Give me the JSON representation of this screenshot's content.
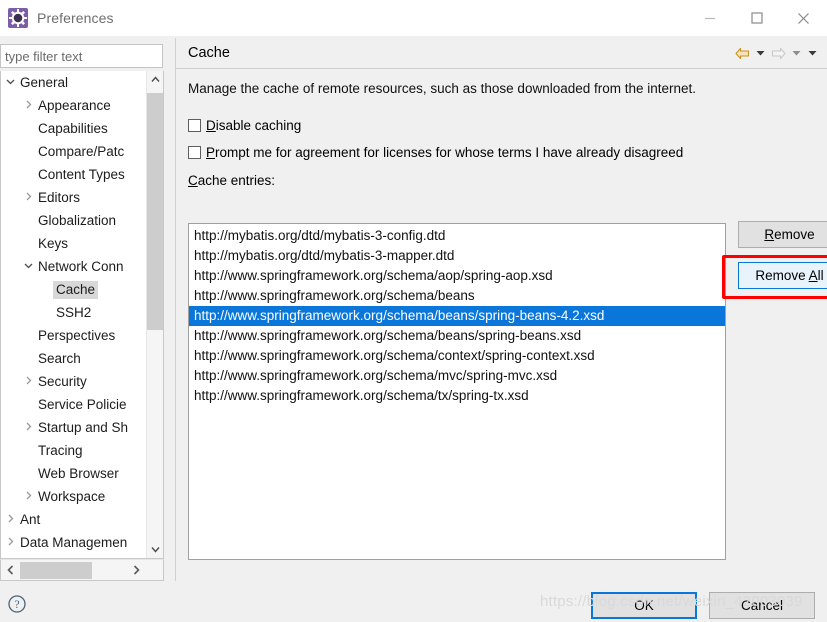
{
  "window": {
    "title": "Preferences",
    "icon": "gear-icon",
    "controls": {
      "minimize": "minimize-icon",
      "maximize": "maximize-icon",
      "close": "close-icon"
    }
  },
  "filter": {
    "placeholder": "type filter text",
    "value": ""
  },
  "tree": {
    "items": [
      {
        "label": "General",
        "indent": 0,
        "arrow": "down",
        "selected": false
      },
      {
        "label": "Appearance",
        "indent": 1,
        "arrow": "right",
        "selected": false
      },
      {
        "label": "Capabilities",
        "indent": 1,
        "arrow": "none",
        "selected": false
      },
      {
        "label": "Compare/Patc",
        "indent": 1,
        "arrow": "none",
        "selected": false
      },
      {
        "label": "Content Types",
        "indent": 1,
        "arrow": "none",
        "selected": false
      },
      {
        "label": "Editors",
        "indent": 1,
        "arrow": "right",
        "selected": false
      },
      {
        "label": "Globalization",
        "indent": 1,
        "arrow": "none",
        "selected": false
      },
      {
        "label": "Keys",
        "indent": 1,
        "arrow": "none",
        "selected": false
      },
      {
        "label": "Network Conn",
        "indent": 1,
        "arrow": "down",
        "selected": false
      },
      {
        "label": "Cache",
        "indent": 2,
        "arrow": "none",
        "selected": true
      },
      {
        "label": "SSH2",
        "indent": 2,
        "arrow": "none",
        "selected": false
      },
      {
        "label": "Perspectives",
        "indent": 1,
        "arrow": "none",
        "selected": false
      },
      {
        "label": "Search",
        "indent": 1,
        "arrow": "none",
        "selected": false
      },
      {
        "label": "Security",
        "indent": 1,
        "arrow": "right",
        "selected": false
      },
      {
        "label": "Service Policie",
        "indent": 1,
        "arrow": "none",
        "selected": false
      },
      {
        "label": "Startup and Sh",
        "indent": 1,
        "arrow": "right",
        "selected": false
      },
      {
        "label": "Tracing",
        "indent": 1,
        "arrow": "none",
        "selected": false
      },
      {
        "label": "Web Browser",
        "indent": 1,
        "arrow": "none",
        "selected": false
      },
      {
        "label": "Workspace",
        "indent": 1,
        "arrow": "right",
        "selected": false
      },
      {
        "label": "Ant",
        "indent": 0,
        "arrow": "right",
        "selected": false
      },
      {
        "label": "Data Managemen",
        "indent": 0,
        "arrow": "right",
        "selected": false
      }
    ]
  },
  "page": {
    "title": "Cache",
    "description": "Manage the cache of remote resources, such as those downloaded from the internet.",
    "nav": {
      "back": "back-arrow-icon",
      "back_menu": "chevron-down-icon",
      "forward": "forward-arrow-icon",
      "forward_menu": "chevron-down-icon",
      "view_menu": "chevron-down-icon"
    },
    "checkboxes": [
      {
        "label": "Disable caching",
        "mnemonic": "D",
        "checked": false
      },
      {
        "label": "Prompt me for agreement for licenses for whose terms I have already disagreed",
        "mnemonic": "P",
        "checked": false
      }
    ],
    "entries_label": "Cache entries:",
    "entries_label_mnemonic": "C",
    "entries": [
      {
        "url": "http://mybatis.org/dtd/mybatis-3-config.dtd",
        "selected": false
      },
      {
        "url": "http://mybatis.org/dtd/mybatis-3-mapper.dtd",
        "selected": false
      },
      {
        "url": "http://www.springframework.org/schema/aop/spring-aop.xsd",
        "selected": false
      },
      {
        "url": "http://www.springframework.org/schema/beans",
        "selected": false
      },
      {
        "url": "http://www.springframework.org/schema/beans/spring-beans-4.2.xsd",
        "selected": true
      },
      {
        "url": "http://www.springframework.org/schema/beans/spring-beans.xsd",
        "selected": false
      },
      {
        "url": "http://www.springframework.org/schema/context/spring-context.xsd",
        "selected": false
      },
      {
        "url": "http://www.springframework.org/schema/mvc/spring-mvc.xsd",
        "selected": false
      },
      {
        "url": "http://www.springframework.org/schema/tx/spring-tx.xsd",
        "selected": false
      }
    ],
    "buttons": {
      "remove": "Remove",
      "remove_mnemonic": "R",
      "remove_all": "Remove All",
      "remove_all_mnemonic": "A"
    }
  },
  "footer": {
    "help": "help-icon",
    "ok": "OK",
    "cancel": "Cancel"
  },
  "watermark": "https://blog.csdn.net/weixin_42003039",
  "colors": {
    "selection_blue": "#0b76d9",
    "annotation_red": "#ff0000",
    "back_arrow_gold": "#e8a33d",
    "title_icon_purple": "#7b5ea7"
  }
}
